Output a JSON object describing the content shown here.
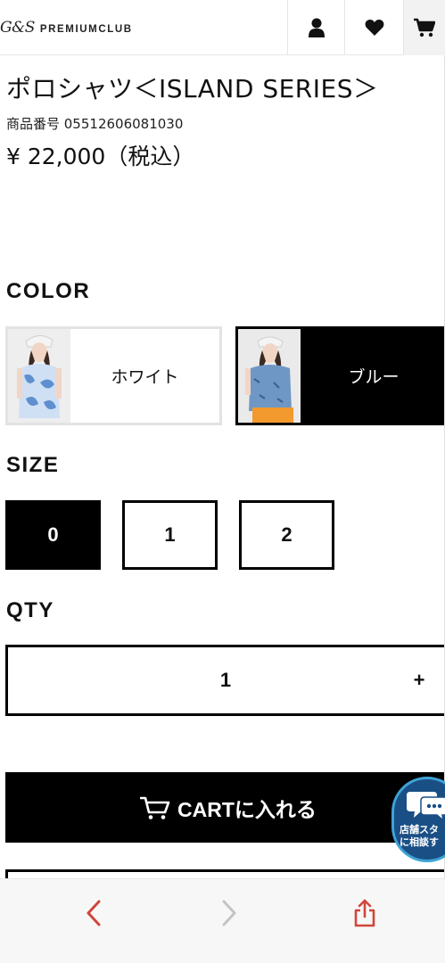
{
  "header": {
    "logo_mark": "G&S",
    "logo_text": "PREMIUMCLUB",
    "icons": [
      "user-icon",
      "heart-icon",
      "cart-icon"
    ]
  },
  "product": {
    "title": "ポロシャツ＜ISLAND SERIES＞",
    "sku": "商品番号 05512606081030",
    "price": "¥ 22,000（税込）"
  },
  "color_section": {
    "label": "COLOR",
    "options": [
      {
        "name": "ホワイト",
        "selected": false
      },
      {
        "name": "ブルー",
        "selected": true
      }
    ]
  },
  "size_section": {
    "label": "SIZE",
    "options": [
      {
        "value": "0",
        "selected": true
      },
      {
        "value": "1",
        "selected": false
      },
      {
        "value": "2",
        "selected": false
      }
    ]
  },
  "qty_section": {
    "label": "QTY",
    "value": "1",
    "plus": "+"
  },
  "cart_button": {
    "label": "CARTに入れる",
    "icon": "cart-outline-icon"
  },
  "chat_badge": {
    "line1": "店舗スタ",
    "line2": "に相談す"
  },
  "browser_bar": {
    "icons": [
      "back-arrow-icon",
      "forward-arrow-icon",
      "share-icon"
    ]
  },
  "colors": {
    "accent_red": "#d0463b",
    "chat_blue": "#1a4f86",
    "black": "#000000"
  }
}
